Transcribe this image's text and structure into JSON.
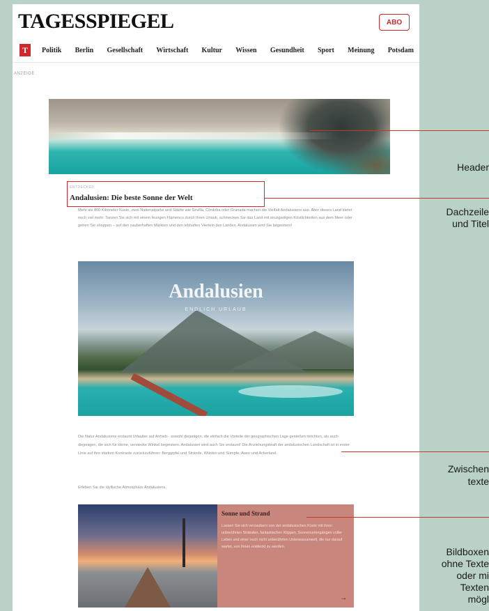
{
  "site": {
    "logo": "TAGESSPIEGEL",
    "abo": "ABO",
    "nav_icon": "T",
    "nav": [
      "Politik",
      "Berlin",
      "Gesellschaft",
      "Wirtschaft",
      "Kultur",
      "Wissen",
      "Gesundheit",
      "Sport",
      "Meinung",
      "Potsdam"
    ]
  },
  "ad_label": "ANZEIGE",
  "article": {
    "kicker": "ENTDECKER",
    "title": "Andalusien: Die beste Sonne der Welt",
    "intro": "Mehr als 800 Kilometer Küste, zwei Nationalparks und Städte wie Sevilla, Córdoba oder Granada machen die Vielfalt Andalusiens aus. Aber dieses Land bietet noch viel mehr. Tanzen Sie sich mit einem feurigen Flamenco durch Ihren Urlaub, schmecken Sie das Land mit einzigartigen Köstlichkeiten aus dem Meer oder gehen Sie shoppen – auf den zauberhaften Märkten und den lebhaften Vierteln des Landes. Andalusien wird Sie begeistern!",
    "image_title": "Andalusien",
    "image_subtitle": "ENDLICH URLAUB",
    "body": "Die Natur Andalusiens erstaunt Urlauber auf Anhieb - sowohl diejenigen, die einfach die Vorteile der geographischen Lage genießen möchten, als auch diejenigen, die sich für kleine, verstecke Winkel begeistern. Andalusien wird auch Sie erstaunt! Die Anziehungskraft der andalusischen Landschaft ist in erster Linie auf ihre starken Kontraste zurückzuführen: Berggipfel und Strände, Wüsten und Sümpfe, Auen und Ackerland.",
    "body2": "Erleben Sie die idyllische Atmosphäre Andalusiens.",
    "box_title": "Sonne und Strand",
    "box_body": "Lassen Sie sich verzaubern von der andalusischen Küste mit ihren unberührten Stränden, fantastischen Klippen, Sonnenuntergängen voller Leben und einer noch nicht unberührten Unterwasserwelt, die nur darauf wartet, von Ihnen entdeckt zu werden.",
    "box_arrow": "→"
  },
  "annotations": {
    "header": "Header",
    "title_1": "Dachzeile",
    "title_2": "und Titel",
    "zwischen_1": "Zwischen",
    "zwischen_2": "texte",
    "bild_1": "Bildboxen",
    "bild_2": "ohne Texte",
    "bild_3": "oder mi",
    "bild_4": "Texten",
    "bild_5": "mögl"
  },
  "colors": {
    "background": "#b9d1c6",
    "accent": "#d1262b",
    "box": "#c9867c"
  }
}
